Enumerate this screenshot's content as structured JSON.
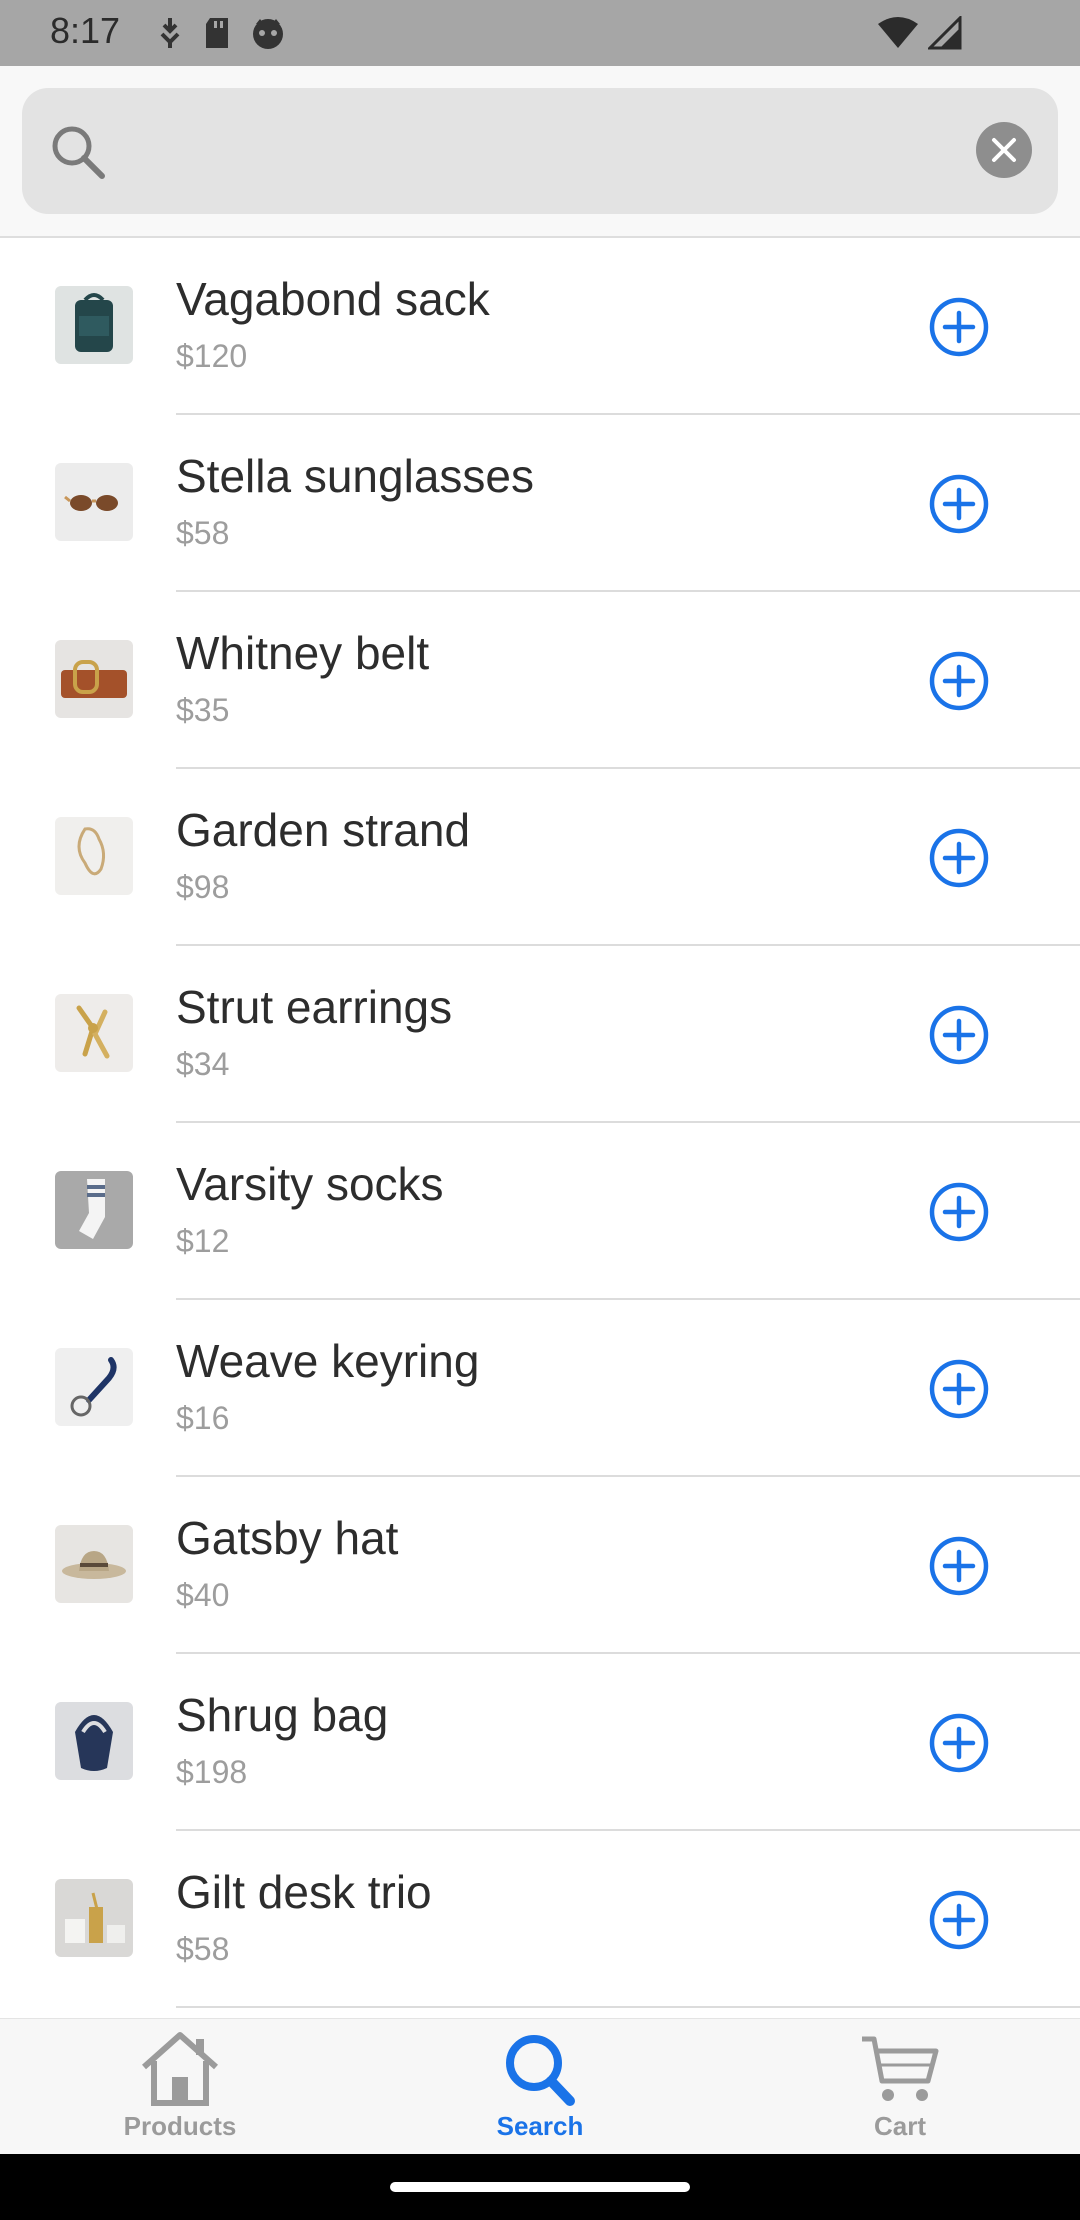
{
  "status_bar": {
    "time": "8:17"
  },
  "search": {
    "placeholder": "",
    "value": ""
  },
  "products": [
    {
      "name": "Vagabond sack",
      "price": "$120",
      "icon": "backpack-image"
    },
    {
      "name": "Stella sunglasses",
      "price": "$58",
      "icon": "sunglasses-image"
    },
    {
      "name": "Whitney belt",
      "price": "$35",
      "icon": "belt-image"
    },
    {
      "name": "Garden strand",
      "price": "$98",
      "icon": "necklace-image"
    },
    {
      "name": "Strut earrings",
      "price": "$34",
      "icon": "earrings-image"
    },
    {
      "name": "Varsity socks",
      "price": "$12",
      "icon": "socks-image"
    },
    {
      "name": "Weave keyring",
      "price": "$16",
      "icon": "keyring-image"
    },
    {
      "name": "Gatsby hat",
      "price": "$40",
      "icon": "hat-image"
    },
    {
      "name": "Shrug bag",
      "price": "$198",
      "icon": "bag-image"
    },
    {
      "name": "Gilt desk trio",
      "price": "$58",
      "icon": "desk-trio-image"
    }
  ],
  "bottom_nav": {
    "items": [
      {
        "label": "Products",
        "icon": "home-icon",
        "active": false
      },
      {
        "label": "Search",
        "icon": "search-icon",
        "active": true
      },
      {
        "label": "Cart",
        "icon": "cart-icon",
        "active": false
      }
    ]
  },
  "colors": {
    "accent": "#1a73e8",
    "status_bar": "#a6a6a6",
    "search_field": "#e3e3e3",
    "nav_inactive": "#9b9b9b"
  }
}
